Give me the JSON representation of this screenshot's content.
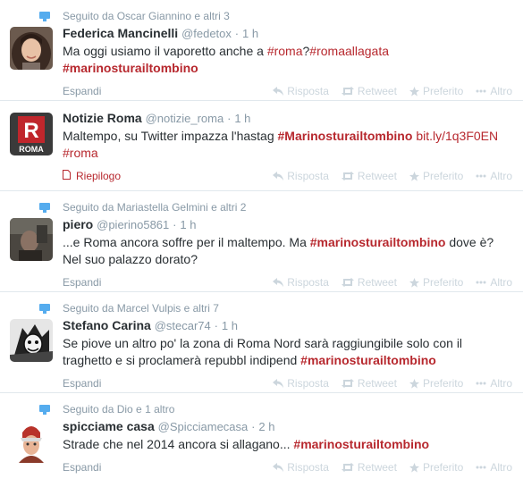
{
  "tweets": [
    {
      "context": "Seguito da Oscar Giannino e altri 3",
      "fullname": "Federica Mancinelli",
      "username": "@fedetox",
      "time": "1 h",
      "line1_pre": "Ma oggi usiamo il vaporetto anche a ",
      "line1_tag1": "#roma",
      "line1_mid": "?",
      "line1_tag2": "#romaallagata",
      "line2_tag": "#marinosturailtombino",
      "footer_left": "Espandi"
    },
    {
      "fullname": "Notizie Roma",
      "username": "@notizie_roma",
      "time": "1 h",
      "line1_pre": "Maltempo, su Twitter impazza l'hastag ",
      "line1_tag": "#Marinosturailtombino",
      "line1_space": " ",
      "line1_link": "bit.ly/1q3F0EN",
      "line2_tag": "#roma",
      "footer_left": "Riepilogo",
      "avatar_letter": "R",
      "avatar_label": "ROMA"
    },
    {
      "context": "Seguito da Mariastella Gelmini e altri 2",
      "fullname": "piero",
      "username": "@pierino5861",
      "time": "1 h",
      "line1_pre": "...e Roma ancora soffre per il maltempo. Ma ",
      "line1_tag": "#marinosturailtombino",
      "line1_post": " dove è?",
      "line2": "Nel suo palazzo dorato?",
      "footer_left": "Espandi"
    },
    {
      "context": "Seguito da Marcel Vulpis e altri 7",
      "fullname": "Stefano Carina",
      "username": "@stecar74",
      "time": "1 h",
      "line1": "Se piove un altro po' la zona di Roma Nord sarà raggiungibile solo con il",
      "line2_pre": "traghetto e si proclamerà repubbl indipend ",
      "line2_tag": "#marinosturailtombino",
      "footer_left": "Espandi"
    },
    {
      "context": "Seguito da Dio e 1 altro",
      "fullname": "spicciame casa",
      "username": "@Spicciamecasa",
      "time": "2 h",
      "line1_pre": "Strade che nel 2014 ancora si allagano... ",
      "line1_tag": "#marinosturailtombino",
      "footer_left": "Espandi"
    }
  ],
  "actions": {
    "reply": "Risposta",
    "retweet": "Retweet",
    "favorite": "Preferito",
    "more": "Altro"
  },
  "separator": "·",
  "colors": {
    "accent": "#b7282e",
    "muted": "#8899a6",
    "action": "#ccd6dd",
    "context_icon": "#55acee"
  }
}
